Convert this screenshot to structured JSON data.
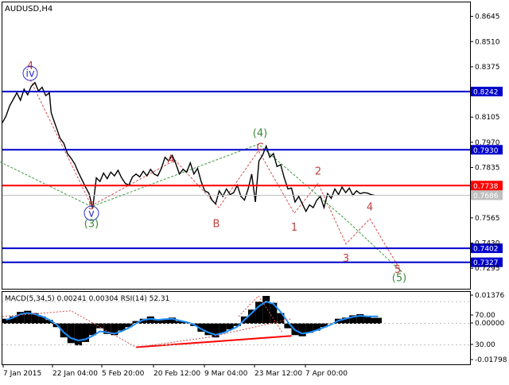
{
  "chart_data": {
    "type": "line",
    "title": "AUDUSD,H4",
    "x_tick_labels": [
      "7 Jan 2015",
      "22 Jan 04:00",
      "5 Feb 20:00",
      "20 Feb 12:00",
      "9 Mar 04:00",
      "23 Mar 12:00",
      "7 Apr 00:00"
    ],
    "price_axis": {
      "ylim": [
        0.7185,
        0.872
      ],
      "tick_labels": [
        "0.8645",
        "0.8510",
        "0.8375",
        "0.8105",
        "0.7970",
        "0.7835",
        "0.7565",
        "0.7430",
        "0.7295"
      ],
      "tick_values": [
        0.8645,
        0.851,
        0.8375,
        0.8105,
        0.797,
        0.7835,
        0.7565,
        0.743,
        0.7295
      ]
    },
    "price_series": {
      "name": "AUDUSD",
      "x": [
        0,
        2,
        4,
        6,
        8,
        10,
        12,
        14,
        16,
        18,
        20,
        22,
        24,
        26,
        27,
        28,
        30,
        32,
        34,
        36,
        38,
        40,
        42,
        44,
        46,
        48,
        50,
        52,
        54,
        56,
        58,
        60,
        62,
        64,
        66,
        68,
        70,
        72,
        74,
        76,
        78,
        80,
        82,
        84,
        86,
        88,
        90,
        92,
        94,
        96,
        98,
        100,
        102,
        104,
        106,
        108,
        110,
        112,
        114,
        116,
        117,
        118,
        120,
        122,
        124,
        126,
        128,
        130,
        132,
        134,
        136,
        138,
        140,
        142,
        144,
        146,
        148,
        150,
        152,
        154,
        156,
        158,
        160,
        162,
        164,
        166,
        168,
        170,
        172,
        174,
        176,
        178,
        180,
        182,
        184,
        186,
        188,
        190,
        192,
        194,
        196,
        198,
        200,
        202,
        204,
        206
      ],
      "y": [
        0.8075,
        0.811,
        0.8165,
        0.82,
        0.8235,
        0.8195,
        0.8255,
        0.8225,
        0.827,
        0.829,
        0.8245,
        0.8265,
        0.822,
        0.8235,
        0.813,
        0.81,
        0.8045,
        0.799,
        0.7965,
        0.791,
        0.7885,
        0.7855,
        0.781,
        0.777,
        0.773,
        0.7695,
        0.7615,
        0.778,
        0.776,
        0.7805,
        0.7775,
        0.781,
        0.779,
        0.782,
        0.778,
        0.775,
        0.774,
        0.7785,
        0.78,
        0.7785,
        0.7815,
        0.779,
        0.7825,
        0.78,
        0.779,
        0.783,
        0.789,
        0.787,
        0.79,
        0.7855,
        0.78,
        0.7825,
        0.781,
        0.786,
        0.78,
        0.783,
        0.776,
        0.771,
        0.77,
        0.766,
        0.765,
        0.764,
        0.771,
        0.768,
        0.772,
        0.769,
        0.77,
        0.774,
        0.768,
        0.766,
        0.772,
        0.78,
        0.765,
        0.787,
        0.79,
        0.795,
        0.789,
        0.791,
        0.784,
        0.785,
        0.778,
        0.772,
        0.7725,
        0.765,
        0.768,
        0.764,
        0.76,
        0.7635,
        0.762,
        0.766,
        0.768,
        0.762,
        0.7695,
        0.767,
        0.772,
        0.769,
        0.773,
        0.77,
        0.7725,
        0.7686,
        0.771,
        0.7695,
        0.77,
        0.7698,
        0.769,
        0.7686
      ]
    },
    "horizontal_levels": [
      {
        "value": 0.8242,
        "label": "0.8242",
        "color": "#0000cd",
        "bg": "#0000cd"
      },
      {
        "value": 0.793,
        "label": "0.7930",
        "color": "#0000cd",
        "bg": "#0000cd"
      },
      {
        "value": 0.7738,
        "label": "0.7738",
        "color": "#ff0000",
        "bg": "#ff0000"
      },
      {
        "value": 0.7402,
        "label": "0.7402",
        "color": "#0000cd",
        "bg": "#0000cd"
      },
      {
        "value": 0.7327,
        "label": "0.7327",
        "color": "#0000cd",
        "bg": "#0000cd"
      }
    ],
    "current_price": {
      "value": 0.7686,
      "label": "0.7686"
    },
    "wave_paths": [
      {
        "color": "#d45050",
        "points": [
          [
            38,
            0.8305
          ],
          [
            115,
            0.763
          ],
          [
            220,
            0.7875
          ],
          [
            275,
            0.762
          ],
          [
            325,
            0.7925
          ],
          [
            370,
            0.759
          ],
          [
            400,
            0.775
          ],
          [
            435,
            0.7425
          ],
          [
            465,
            0.756
          ],
          [
            505,
            0.7275
          ]
        ]
      },
      {
        "color": "#3a9a3a",
        "points": [
          [
            0,
            0.7865
          ],
          [
            115,
            0.7625
          ],
          [
            325,
            0.796
          ],
          [
            435,
            0.7555
          ],
          [
            505,
            0.7275
          ]
        ]
      }
    ],
    "wave_labels": [
      {
        "text": "4",
        "x": 38,
        "y": 0.838,
        "color": "#c04040",
        "circled": false
      },
      {
        "text": "iv",
        "x": 38,
        "y": 0.834,
        "color": "#3030c0",
        "circled": true
      },
      {
        "text": "5",
        "x": 115,
        "y": 0.763,
        "color": "#c04040",
        "circled": false
      },
      {
        "text": "v",
        "x": 115,
        "y": 0.759,
        "color": "#3030c0",
        "circled": true
      },
      {
        "text": "(3)",
        "x": 115,
        "y": 0.7535,
        "color": "#3a8a3a",
        "circled": false
      },
      {
        "text": "A",
        "x": 215,
        "y": 0.788,
        "color": "#c04040",
        "circled": false
      },
      {
        "text": "(4)",
        "x": 327,
        "y": 0.802,
        "color": "#3a8a3a",
        "circled": false
      },
      {
        "text": "C",
        "x": 327,
        "y": 0.7945,
        "color": "#c04040",
        "circled": false
      },
      {
        "text": "B",
        "x": 272,
        "y": 0.7535,
        "color": "#c04040",
        "circled": false
      },
      {
        "text": "2",
        "x": 400,
        "y": 0.7815,
        "color": "#c04040",
        "circled": false
      },
      {
        "text": "1",
        "x": 370,
        "y": 0.7515,
        "color": "#c04040",
        "circled": false
      },
      {
        "text": "4",
        "x": 465,
        "y": 0.7625,
        "color": "#c04040",
        "circled": false
      },
      {
        "text": "3",
        "x": 435,
        "y": 0.735,
        "color": "#c04040",
        "circled": false
      },
      {
        "text": "5",
        "x": 500,
        "y": 0.729,
        "color": "#c04040",
        "circled": false
      },
      {
        "text": "(5)",
        "x": 502,
        "y": 0.7245,
        "color": "#3a8a3a",
        "circled": false
      }
    ],
    "indicator": {
      "label": "MACD(5,34,5) 0.00241 0.00304 RSI(14) 52.31",
      "tick_labels": [
        "0.01376",
        "70.00",
        "0.00000",
        "30.00",
        "-0.01798"
      ],
      "tick_values": [
        0.01376,
        70.0,
        0.0,
        30.0,
        -0.01798
      ],
      "macd_ylim": [
        -0.01798,
        0.01376
      ],
      "macd_x": [
        0,
        4,
        8,
        12,
        16,
        20,
        24,
        28,
        32,
        36,
        40,
        44,
        48,
        52,
        56,
        60,
        64,
        68,
        72,
        76,
        80,
        84,
        88,
        92,
        96,
        100,
        104,
        108,
        112,
        116,
        120,
        124,
        128,
        132,
        136,
        140,
        144,
        148,
        152,
        156,
        160,
        164,
        168,
        172,
        176,
        180,
        184,
        188,
        192,
        196,
        200,
        204,
        206
      ],
      "macd_values": [
        0.002,
        0.003,
        0.005,
        0.0055,
        0.0045,
        0.003,
        0.0015,
        -0.0015,
        -0.006,
        -0.0085,
        -0.0095,
        -0.008,
        -0.005,
        -0.002,
        -0.0045,
        -0.005,
        -0.003,
        -0.0015,
        0.001,
        0.002,
        0.003,
        0.0015,
        0.002,
        0.0025,
        0.001,
        0.0005,
        -0.001,
        -0.0035,
        -0.005,
        -0.006,
        -0.004,
        -0.0025,
        -0.001,
        0.003,
        0.006,
        0.0095,
        0.012,
        0.009,
        0.0045,
        -0.002,
        -0.005,
        -0.0055,
        -0.004,
        -0.003,
        -0.0015,
        0.0,
        0.002,
        0.0025,
        0.0035,
        0.004,
        0.003,
        0.0024,
        0.0024
      ],
      "signal_values": [
        0.0015,
        0.0025,
        0.004,
        0.0045,
        0.004,
        0.003,
        0.0015,
        -0.0005,
        -0.004,
        -0.0065,
        -0.0075,
        -0.007,
        -0.0055,
        -0.0035,
        -0.004,
        -0.0045,
        -0.0035,
        -0.002,
        0.0,
        0.0015,
        0.002,
        0.0015,
        0.0018,
        0.002,
        0.0012,
        0.0005,
        -0.0005,
        -0.0025,
        -0.004,
        -0.005,
        -0.0042,
        -0.003,
        -0.0015,
        0.0015,
        0.0045,
        0.0075,
        0.0095,
        0.0085,
        0.005,
        0.0005,
        -0.003,
        -0.0045,
        -0.004,
        -0.003,
        -0.0018,
        -0.0005,
        0.0012,
        0.002,
        0.0028,
        0.0033,
        0.003,
        0.003,
        0.003
      ],
      "divergence_line": {
        "x": [
          74,
          160
        ],
        "value": [
          -0.0105,
          -0.0055
        ]
      },
      "divergence_wave": {
        "x": [
          0,
          38,
          74,
          115,
          160
        ],
        "value": [
          0.003,
          0.0055,
          -0.0105,
          -0.006,
          0.002
        ]
      },
      "macd_wave": {
        "x": [
          300,
          325,
          355
        ],
        "value": [
          0.003,
          0.012,
          -0.004
        ]
      }
    }
  }
}
